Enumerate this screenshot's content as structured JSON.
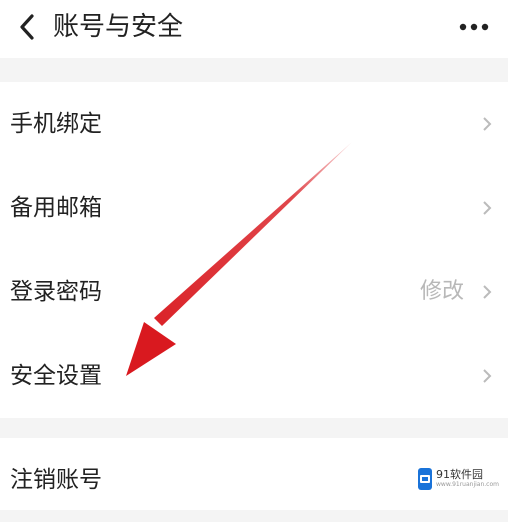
{
  "header": {
    "title": "账号与安全",
    "back_icon": "chevron-left-icon",
    "more_icon": "more-horizontal-icon"
  },
  "settings": {
    "group1": [
      {
        "label": "手机绑定",
        "value": "",
        "icon": "chevron-right-icon"
      },
      {
        "label": "备用邮箱",
        "value": "",
        "icon": "chevron-right-icon"
      },
      {
        "label": "登录密码",
        "value": "修改",
        "icon": "chevron-right-icon"
      },
      {
        "label": "安全设置",
        "value": "",
        "icon": "chevron-right-icon"
      }
    ],
    "group2": [
      {
        "label": "注销账号",
        "value": "",
        "icon": "chevron-right-icon"
      }
    ]
  },
  "annotation": {
    "arrow_color": "#d9191f"
  },
  "watermark": {
    "logo_icon": "watermark-logo-icon",
    "text": "91软件园",
    "sub": "www.91ruanjian.com"
  }
}
